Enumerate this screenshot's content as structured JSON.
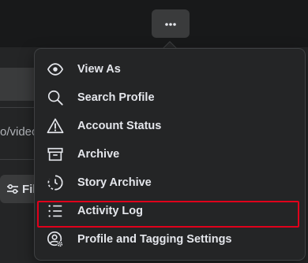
{
  "background": {
    "url_fragment": "o/video",
    "filter_button_label": "Fil"
  },
  "more_button": {
    "icon": "more-horizontal-icon"
  },
  "menu": {
    "items": [
      {
        "label": "View As",
        "icon": "eye-icon"
      },
      {
        "label": "Search Profile",
        "icon": "search-icon"
      },
      {
        "label": "Account Status",
        "icon": "warning-icon"
      },
      {
        "label": "Archive",
        "icon": "archive-icon"
      },
      {
        "label": "Story Archive",
        "icon": "story-archive-icon"
      },
      {
        "label": "Activity Log",
        "icon": "list-icon",
        "highlighted": true
      },
      {
        "label": "Profile and Tagging Settings",
        "icon": "profile-settings-icon"
      }
    ]
  },
  "colors": {
    "highlight": "#e0001b",
    "menu_bg": "#242526",
    "text": "#e4e6eb"
  }
}
